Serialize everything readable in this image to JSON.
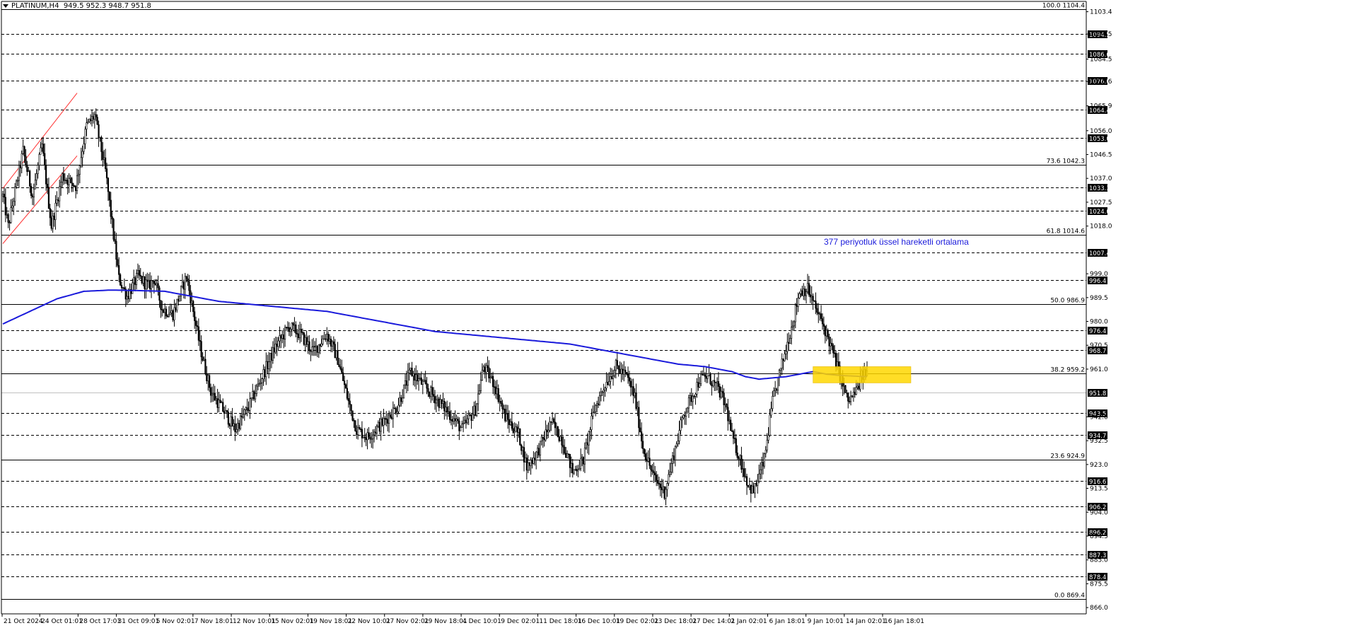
{
  "header": {
    "symbol": "PLATINUM,H4",
    "ohlc": "949.5 952.3 948.7 951.8"
  },
  "annotation": {
    "text": "377 periyotluk üssel hareketli ortalama",
    "color": "#1a1adb"
  },
  "colors": {
    "background": "#ffffff",
    "candle": "#000000",
    "ema": "#1a1adb",
    "zone": "#ffd700",
    "channel": "#ff3333",
    "current_price_line": "#c0c0c0"
  },
  "chart_data": {
    "type": "candlestick",
    "ylim": [
      863.5,
      1107.5
    ],
    "grid": false,
    "price_ticks": [
      "1103.4",
      "1094.5",
      "1084.5",
      "1075.6",
      "1065.9",
      "1056.0",
      "1046.5",
      "1037.0",
      "1027.5",
      "1018.0",
      "999.0",
      "989.5",
      "980.0",
      "970.5",
      "961.0",
      "942.0",
      "932.5",
      "923.0",
      "913.5",
      "904.0",
      "894.5",
      "885.0",
      "875.5",
      "866.0"
    ],
    "levels": [
      "1094.5",
      "1086.6",
      "1076.0",
      "1064.4",
      "1053.0",
      "1033.3",
      "1024.0",
      "1007.4",
      "996.4",
      "976.4",
      "968.7",
      "951.8",
      "943.5",
      "934.7",
      "916.6",
      "906.2",
      "896.2",
      "887.3",
      "878.4"
    ],
    "fibonacci": [
      {
        "label": "100.0 1104.4",
        "level": 1104.4
      },
      {
        "label": "73.6 1042.3",
        "level": 1042.3
      },
      {
        "label": "61.8 1014.6",
        "level": 1014.6
      },
      {
        "label": "50.0 986.9",
        "level": 986.9
      },
      {
        "label": "38.2 959.2",
        "level": 959.2
      },
      {
        "label": "23.6 924.9",
        "level": 924.9
      },
      {
        "label": "0.0 869.4",
        "level": 869.4
      }
    ],
    "current_price": 951.8,
    "time_labels": [
      "21 Oct 2024",
      "24 Oct 01:01",
      "28 Oct 17:01",
      "31 Oct 09:01",
      "5 Nov 02:01",
      "7 Nov 18:01",
      "12 Nov 10:01",
      "15 Nov 02:01",
      "19 Nov 18:01",
      "22 Nov 10:01",
      "27 Nov 02:01",
      "29 Nov 18:01",
      "4 Dec 10:01",
      "9 Dec 02:01",
      "11 Dec 18:01",
      "16 Dec 10:01",
      "19 Dec 02:01",
      "23 Dec 18:01",
      "27 Dec 14:01",
      "2 Jan 02:01",
      "6 Jan 18:01",
      "9 Jan 10:01",
      "14 Jan 02:01",
      "16 Jan 18:01"
    ],
    "swing_path": [
      [
        0,
        1030
      ],
      [
        4,
        1018
      ],
      [
        15,
        1048
      ],
      [
        22,
        1030
      ],
      [
        29,
        1050
      ],
      [
        36,
        1018
      ],
      [
        44,
        1038
      ],
      [
        54,
        1034
      ],
      [
        62,
        1058
      ],
      [
        68,
        1062
      ],
      [
        76,
        1040
      ],
      [
        86,
        997
      ],
      [
        92,
        990
      ],
      [
        100,
        998
      ],
      [
        108,
        994
      ],
      [
        112,
        997
      ],
      [
        118,
        985
      ],
      [
        126,
        983
      ],
      [
        136,
        998
      ],
      [
        146,
        970
      ],
      [
        154,
        952
      ],
      [
        164,
        944
      ],
      [
        172,
        937
      ],
      [
        182,
        946
      ],
      [
        192,
        958
      ],
      [
        202,
        970
      ],
      [
        212,
        978
      ],
      [
        220,
        975
      ],
      [
        230,
        968
      ],
      [
        240,
        975
      ],
      [
        248,
        965
      ],
      [
        256,
        948
      ],
      [
        262,
        937
      ],
      [
        270,
        934
      ],
      [
        282,
        940
      ],
      [
        292,
        946
      ],
      [
        302,
        960
      ],
      [
        316,
        952
      ],
      [
        328,
        945
      ],
      [
        340,
        937
      ],
      [
        350,
        945
      ],
      [
        356,
        962
      ],
      [
        364,
        955
      ],
      [
        372,
        942
      ],
      [
        382,
        935
      ],
      [
        388,
        922
      ],
      [
        396,
        928
      ],
      [
        406,
        940
      ],
      [
        414,
        933
      ],
      [
        422,
        920
      ],
      [
        430,
        925
      ],
      [
        438,
        945
      ],
      [
        446,
        955
      ],
      [
        454,
        962
      ],
      [
        462,
        958
      ],
      [
        468,
        950
      ],
      [
        474,
        930
      ],
      [
        482,
        918
      ],
      [
        490,
        912
      ],
      [
        496,
        925
      ],
      [
        504,
        943
      ],
      [
        512,
        952
      ],
      [
        516,
        957
      ],
      [
        522,
        958
      ],
      [
        530,
        953
      ],
      [
        536,
        945
      ],
      [
        540,
        934
      ],
      [
        546,
        925
      ],
      [
        552,
        915
      ],
      [
        556,
        912
      ],
      [
        564,
        925
      ],
      [
        570,
        948
      ],
      [
        578,
        965
      ],
      [
        586,
        982
      ],
      [
        590,
        992
      ],
      [
        596,
        993
      ],
      [
        602,
        985
      ],
      [
        608,
        978
      ],
      [
        612,
        972
      ],
      [
        618,
        962
      ],
      [
        622,
        955
      ],
      [
        626,
        948
      ],
      [
        632,
        952
      ],
      [
        636,
        958
      ],
      [
        640,
        960
      ]
    ],
    "ema_path": [
      [
        0,
        979
      ],
      [
        20,
        984
      ],
      [
        40,
        989
      ],
      [
        60,
        992
      ],
      [
        80,
        992.5
      ],
      [
        100,
        992.3
      ],
      [
        120,
        992
      ],
      [
        140,
        990
      ],
      [
        160,
        988
      ],
      [
        180,
        987
      ],
      [
        200,
        986
      ],
      [
        220,
        985
      ],
      [
        240,
        984
      ],
      [
        260,
        982
      ],
      [
        280,
        980
      ],
      [
        300,
        978
      ],
      [
        320,
        976
      ],
      [
        340,
        975
      ],
      [
        360,
        974
      ],
      [
        380,
        973
      ],
      [
        400,
        972
      ],
      [
        420,
        971
      ],
      [
        440,
        969
      ],
      [
        460,
        967
      ],
      [
        480,
        965
      ],
      [
        500,
        963
      ],
      [
        520,
        962
      ],
      [
        540,
        960
      ],
      [
        550,
        958
      ],
      [
        560,
        957
      ],
      [
        570,
        957.5
      ],
      [
        580,
        958
      ],
      [
        590,
        959
      ],
      [
        600,
        960
      ],
      [
        610,
        959
      ],
      [
        620,
        958.5
      ],
      [
        640,
        958
      ]
    ]
  }
}
